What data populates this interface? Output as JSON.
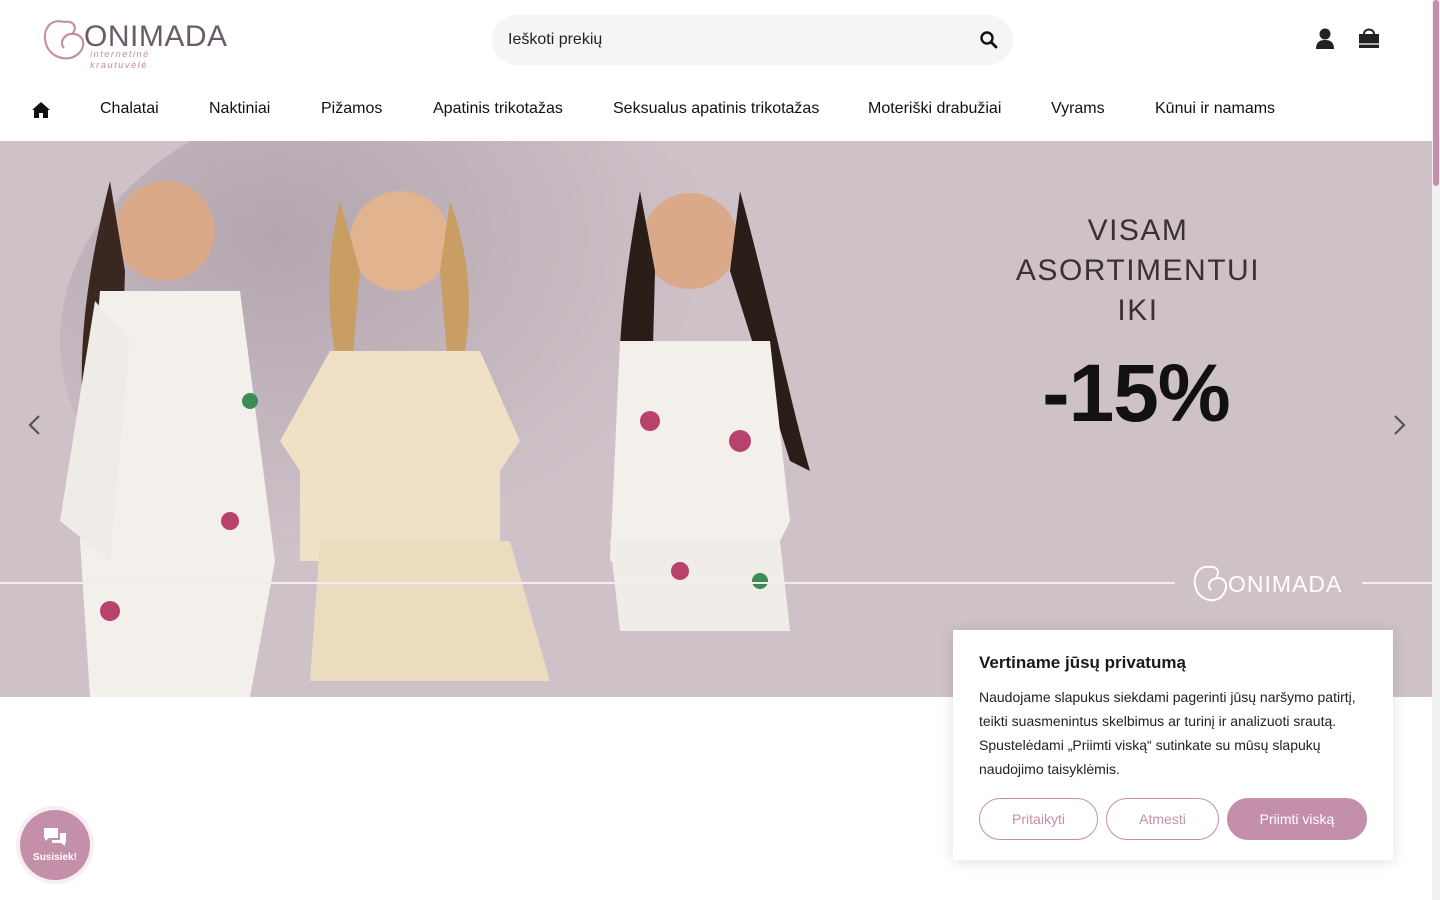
{
  "brand": {
    "logo_b": "B",
    "logo_rest": "ONI",
    "logo_mada": "MADA",
    "logo_sub": "internetinė krautuvėlė",
    "accent": "#c48fa9"
  },
  "search": {
    "placeholder": "Ieškoti prekių",
    "icon": "search-icon"
  },
  "header_icons": [
    "user-icon",
    "shopping-bag-icon"
  ],
  "nav": {
    "home_icon": "home-icon",
    "items": [
      {
        "label": "Chalatai"
      },
      {
        "label": "Naktiniai"
      },
      {
        "label": "Pižamos"
      },
      {
        "label": "Apatinis trikotažas"
      },
      {
        "label": "Seksualus apatinis trikotažas"
      },
      {
        "label": "Moteriški drabužiai"
      },
      {
        "label": "Vyrams"
      },
      {
        "label": "Kūnui ir namams"
      }
    ]
  },
  "hero": {
    "headline_1": "VISAM ASORTIMENTUI",
    "headline_2": "IKI",
    "discount": "-15%",
    "brand_watermark": "BONIMADA",
    "background": "#cfc1c8"
  },
  "cookie": {
    "title": "Vertiname jūsų privatumą",
    "text": "Naudojame slapukus siekdami pagerinti jūsų naršymo patirtį, teikti suasmenintus skelbimus ar turinį ir analizuoti srautą. Spustelėdami „Priimti viską“ sutinkate su mūsų slapukų naudojimo taisyklėmis.",
    "customize_label": "Pritaikyti",
    "reject_label": "Atmesti",
    "accept_label": "Priimti viską"
  },
  "chat": {
    "label": "Susisiek!",
    "icon": "chat-bubbles-icon"
  }
}
